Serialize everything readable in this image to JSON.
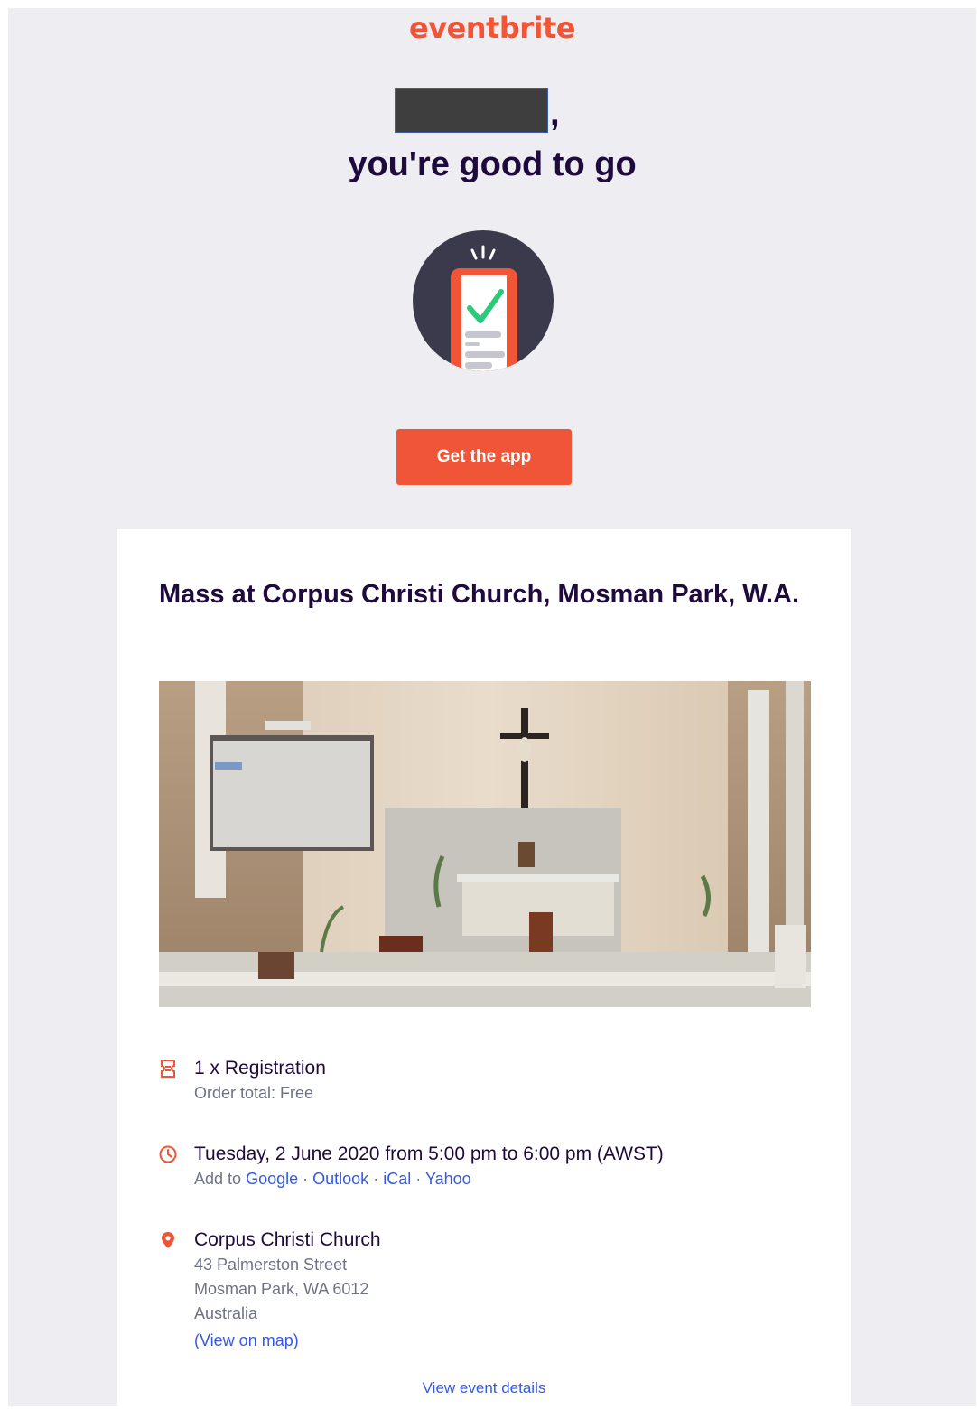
{
  "brand": {
    "logo_text": "eventbrite",
    "accent": "#f05537",
    "ink": "#1e0a3c"
  },
  "greeting": {
    "suffix": ",",
    "line2": "you're good to go"
  },
  "cta": {
    "label": "Get the app"
  },
  "event": {
    "title": "Mass at Corpus Christi Church, Mosman Park, W.A.",
    "ticket": {
      "icon": "ticket-icon",
      "line": "1 x Registration",
      "total": "Order total: Free"
    },
    "datetime": {
      "icon": "clock-icon",
      "line": "Tuesday, 2 June 2020 from 5:00 pm to 6:00 pm (AWST)",
      "add_to": "Add to",
      "calendars": [
        "Google",
        "Outlook",
        "iCal",
        "Yahoo"
      ],
      "separator": "·"
    },
    "location": {
      "icon": "map-pin-icon",
      "venue": "Corpus Christi Church",
      "address": [
        "43 Palmerston Street",
        "Mosman Park, WA 6012",
        "Australia"
      ],
      "map_link": "(View on map)"
    },
    "details_link": "View event details"
  }
}
